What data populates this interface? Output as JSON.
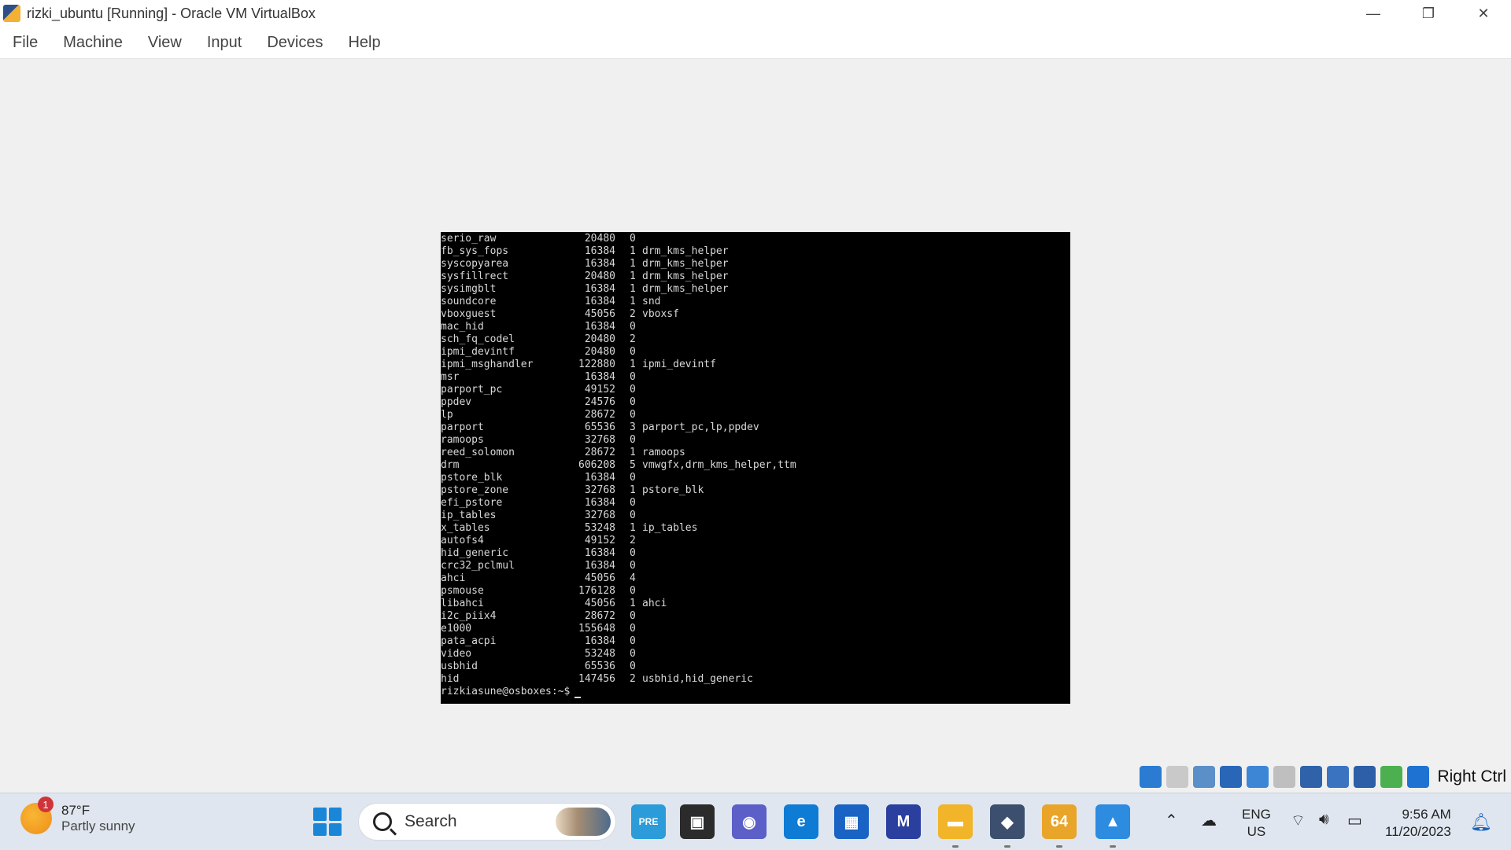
{
  "window": {
    "title": "rizki_ubuntu [Running] - Oracle VM VirtualBox",
    "minimize_glyph": "—",
    "restore_glyph": "❐",
    "close_glyph": "✕"
  },
  "menu": {
    "file": "File",
    "machine": "Machine",
    "view": "View",
    "input": "Input",
    "devices": "Devices",
    "help": "Help"
  },
  "terminal": {
    "lines": [
      {
        "module": "serio_raw",
        "size": "20480",
        "used": "0",
        "by": ""
      },
      {
        "module": "fb_sys_fops",
        "size": "16384",
        "used": "1",
        "by": "drm_kms_helper"
      },
      {
        "module": "syscopyarea",
        "size": "16384",
        "used": "1",
        "by": "drm_kms_helper"
      },
      {
        "module": "sysfillrect",
        "size": "20480",
        "used": "1",
        "by": "drm_kms_helper"
      },
      {
        "module": "sysimgblt",
        "size": "16384",
        "used": "1",
        "by": "drm_kms_helper"
      },
      {
        "module": "soundcore",
        "size": "16384",
        "used": "1",
        "by": "snd"
      },
      {
        "module": "vboxguest",
        "size": "45056",
        "used": "2",
        "by": "vboxsf"
      },
      {
        "module": "mac_hid",
        "size": "16384",
        "used": "0",
        "by": ""
      },
      {
        "module": "sch_fq_codel",
        "size": "20480",
        "used": "2",
        "by": ""
      },
      {
        "module": "ipmi_devintf",
        "size": "20480",
        "used": "0",
        "by": ""
      },
      {
        "module": "ipmi_msghandler",
        "size": "122880",
        "used": "1",
        "by": "ipmi_devintf"
      },
      {
        "module": "msr",
        "size": "16384",
        "used": "0",
        "by": ""
      },
      {
        "module": "parport_pc",
        "size": "49152",
        "used": "0",
        "by": ""
      },
      {
        "module": "ppdev",
        "size": "24576",
        "used": "0",
        "by": ""
      },
      {
        "module": "lp",
        "size": "28672",
        "used": "0",
        "by": ""
      },
      {
        "module": "parport",
        "size": "65536",
        "used": "3",
        "by": "parport_pc,lp,ppdev"
      },
      {
        "module": "ramoops",
        "size": "32768",
        "used": "0",
        "by": ""
      },
      {
        "module": "reed_solomon",
        "size": "28672",
        "used": "1",
        "by": "ramoops"
      },
      {
        "module": "drm",
        "size": "606208",
        "used": "5",
        "by": "vmwgfx,drm_kms_helper,ttm"
      },
      {
        "module": "pstore_blk",
        "size": "16384",
        "used": "0",
        "by": ""
      },
      {
        "module": "pstore_zone",
        "size": "32768",
        "used": "1",
        "by": "pstore_blk"
      },
      {
        "module": "efi_pstore",
        "size": "16384",
        "used": "0",
        "by": ""
      },
      {
        "module": "ip_tables",
        "size": "32768",
        "used": "0",
        "by": ""
      },
      {
        "module": "x_tables",
        "size": "53248",
        "used": "1",
        "by": "ip_tables"
      },
      {
        "module": "autofs4",
        "size": "49152",
        "used": "2",
        "by": ""
      },
      {
        "module": "hid_generic",
        "size": "16384",
        "used": "0",
        "by": ""
      },
      {
        "module": "crc32_pclmul",
        "size": "16384",
        "used": "0",
        "by": ""
      },
      {
        "module": "ahci",
        "size": "45056",
        "used": "4",
        "by": ""
      },
      {
        "module": "psmouse",
        "size": "176128",
        "used": "0",
        "by": ""
      },
      {
        "module": "libahci",
        "size": "45056",
        "used": "1",
        "by": "ahci"
      },
      {
        "module": "i2c_piix4",
        "size": "28672",
        "used": "0",
        "by": ""
      },
      {
        "module": "e1000",
        "size": "155648",
        "used": "0",
        "by": ""
      },
      {
        "module": "pata_acpi",
        "size": "16384",
        "used": "0",
        "by": ""
      },
      {
        "module": "video",
        "size": "53248",
        "used": "0",
        "by": ""
      },
      {
        "module": "usbhid",
        "size": "65536",
        "used": "0",
        "by": ""
      },
      {
        "module": "hid",
        "size": "147456",
        "used": "2",
        "by": "usbhid,hid_generic"
      }
    ],
    "prompt": "rizkiasune@osboxes:~$"
  },
  "vm_status": {
    "icons": [
      {
        "name": "hard-disk-icon",
        "color": "#2a7bd1"
      },
      {
        "name": "optical-drive-icon",
        "color": "#c9c9c9"
      },
      {
        "name": "audio-icon",
        "color": "#5a8fc8"
      },
      {
        "name": "network-icon",
        "color": "#2a66b8"
      },
      {
        "name": "usb-icon",
        "color": "#3d86d6"
      },
      {
        "name": "shared-folders-icon",
        "color": "#bfbfbf"
      },
      {
        "name": "display-icon",
        "color": "#2f62a8"
      },
      {
        "name": "recording-icon",
        "color": "#3a74c0"
      },
      {
        "name": "cpu-icon",
        "color": "#2d5fa8"
      },
      {
        "name": "mouse-integration-icon",
        "color": "#4caf50"
      },
      {
        "name": "keyboard-capture-icon",
        "color": "#1e73d2"
      }
    ],
    "host_key": "Right Ctrl"
  },
  "taskbar": {
    "weather": {
      "temp": "87°F",
      "desc": "Partly sunny",
      "badge": "1"
    },
    "search_placeholder": "Search",
    "apps": [
      {
        "name": "copilot-preview-icon",
        "label": "PRE",
        "color": "#2b9bd9"
      },
      {
        "name": "task-view-icon",
        "label": "▣",
        "color": "#2b2b2b"
      },
      {
        "name": "chat-icon",
        "label": "◉",
        "color": "#5b5fc7"
      },
      {
        "name": "edge-icon",
        "label": "e",
        "color": "#0e7bd5"
      },
      {
        "name": "store-icon",
        "label": "▦",
        "color": "#1863c4"
      },
      {
        "name": "virtualbox-manager-icon",
        "label": "M",
        "color": "#2a3f9e"
      },
      {
        "name": "file-explorer-icon",
        "label": "▬",
        "color": "#f2b428"
      },
      {
        "name": "virtualbox-icon",
        "label": "◆",
        "color": "#3d4f6e"
      },
      {
        "name": "vm-window-icon",
        "label": "64",
        "color": "#e8a52a"
      },
      {
        "name": "photos-icon",
        "label": "▲",
        "color": "#2d8be0"
      }
    ],
    "lang_top": "ENG",
    "lang_bottom": "US",
    "time": "9:56 AM",
    "date": "11/20/2023"
  }
}
